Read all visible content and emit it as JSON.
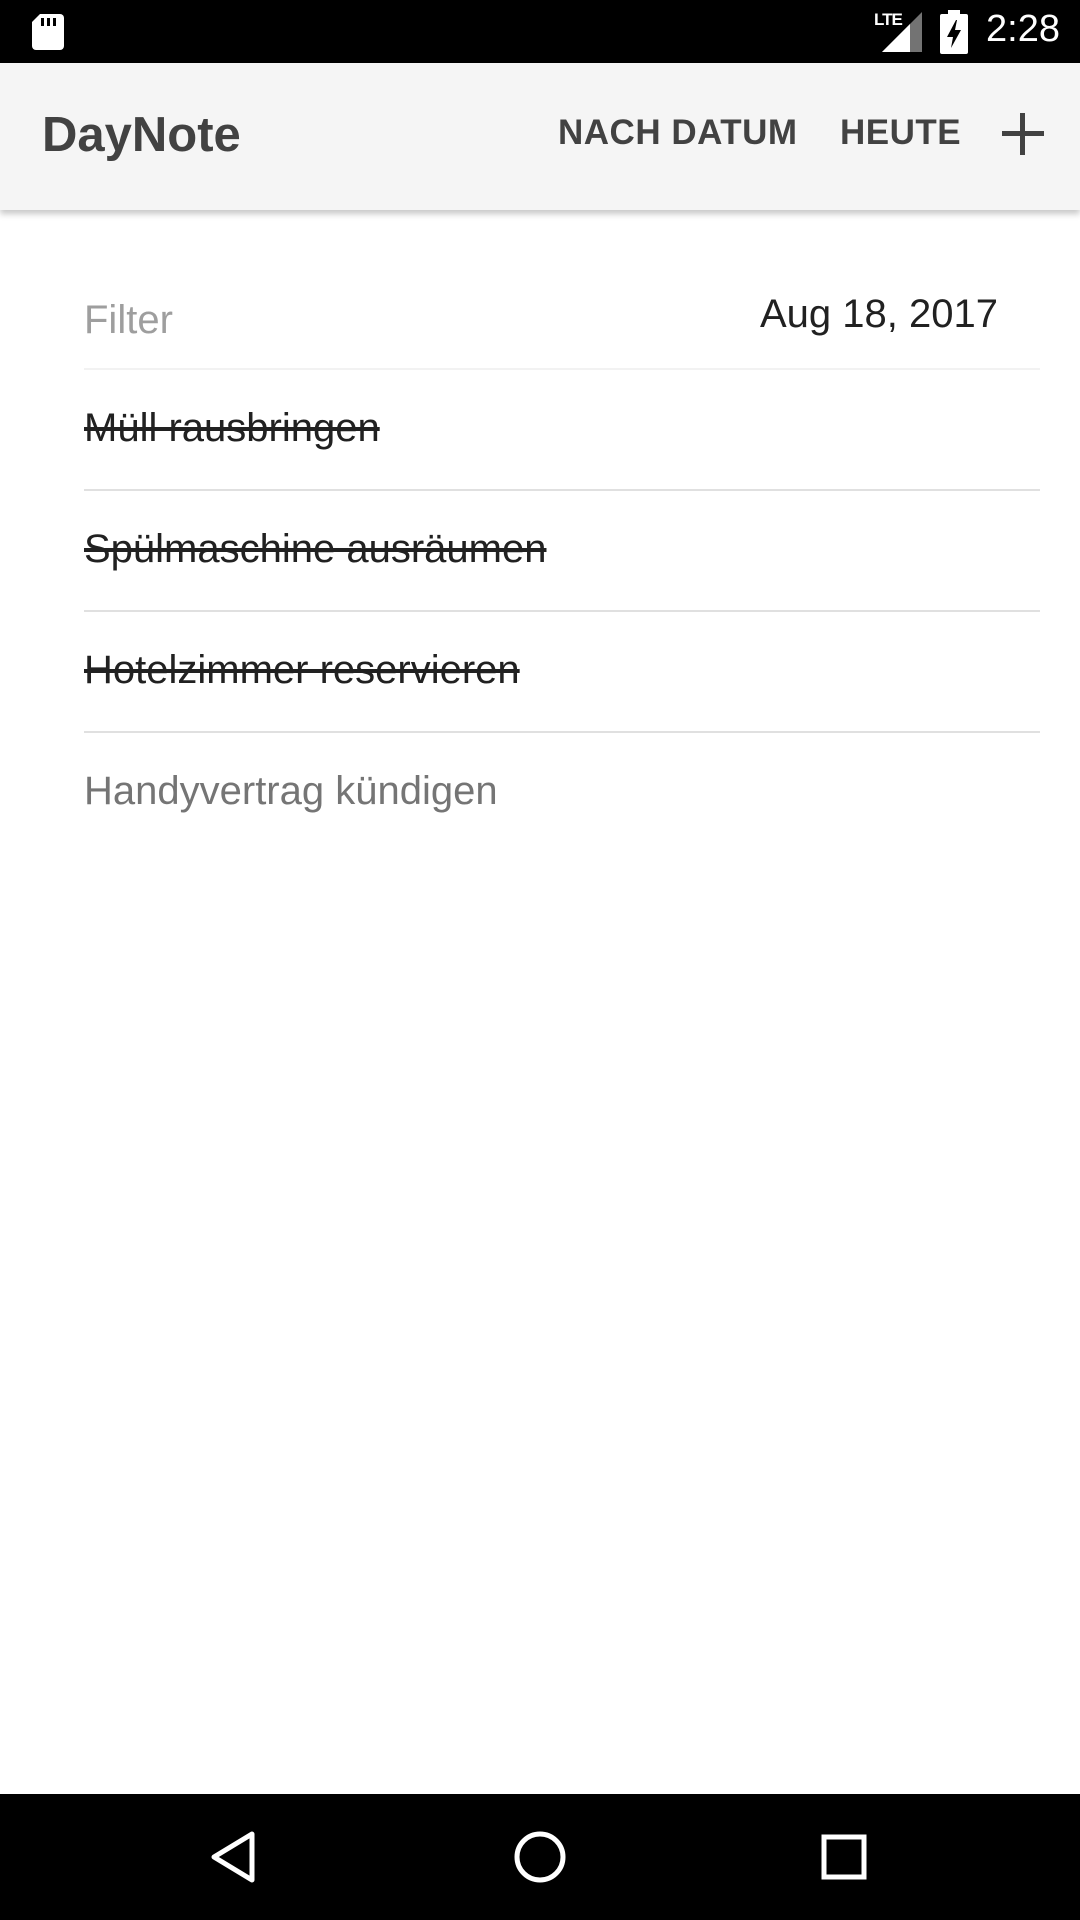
{
  "status_bar": {
    "time": "2:28",
    "network": "LTE",
    "icons": [
      "sd-card-icon",
      "signal-icon",
      "battery-charging-icon"
    ]
  },
  "app_bar": {
    "title": "DayNote",
    "actions": {
      "by_date": "NACH DATUM",
      "today": "HEUTE",
      "add_icon": "plus-icon"
    }
  },
  "filter": {
    "placeholder": "Filter",
    "value": "",
    "date": "Aug 18, 2017"
  },
  "notes": [
    {
      "text": "Müll rausbringen",
      "done": true
    },
    {
      "text": "Spülmaschine ausräumen",
      "done": true
    },
    {
      "text": "Hotelzimmer reservieren",
      "done": true
    },
    {
      "text": "Handyvertrag kündigen",
      "done": false
    }
  ],
  "nav_bar": {
    "icons": [
      "back-icon",
      "home-icon",
      "recents-icon"
    ]
  },
  "colors": {
    "app_bar_bg": "#f5f5f5",
    "title": "#424242",
    "text": "#212121",
    "muted_text": "#757575",
    "placeholder": "#9e9e9e",
    "divider": "#e0e0e0",
    "system_bars": "#000000"
  }
}
